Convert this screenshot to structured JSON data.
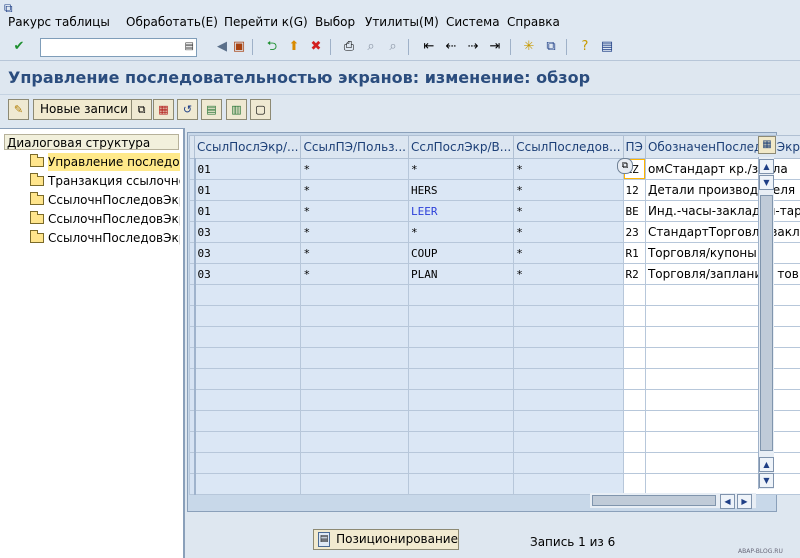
{
  "menubar": {
    "items": [
      "Ракурс таблицы",
      "Обработать(E)",
      "Перейти к(G)",
      "Выбор",
      "Утилиты(M)",
      "Система",
      "Справка"
    ]
  },
  "toolbar": {
    "command_field_value": "",
    "icons": [
      "enter-icon",
      "command-history-icon",
      "back-icon",
      "save-icon",
      "back-green-icon",
      "exit-icon",
      "cancel-icon",
      "print-icon",
      "find-icon",
      "find-next-icon",
      "first-page-icon",
      "previous-page-icon",
      "next-page-icon",
      "last-page-icon",
      "new-session-icon",
      "shortcut-icon",
      "help-icon",
      "layout-menu-icon"
    ]
  },
  "title": {
    "text": "Управление последовательностью экранов: изменение: обзор"
  },
  "app_toolbar": {
    "new_entries_label": "Новые записи",
    "icons": [
      "display-change-icon",
      "copy-icon",
      "delete-icon",
      "undo-icon",
      "select-all-icon",
      "select-block-icon",
      "deselect-all-icon"
    ]
  },
  "tree": {
    "header": "Диалоговая структура",
    "nodes": [
      {
        "label": "Управление последова",
        "selected": true
      },
      {
        "label": "Транзакция ссылочной",
        "selected": false
      },
      {
        "label": "СсылочнПоследовЭкра",
        "selected": false
      },
      {
        "label": "СсылочнПоследовЭкра",
        "selected": false
      },
      {
        "label": "СсылочнПоследовЭкра",
        "selected": false
      }
    ]
  },
  "table": {
    "columns": [
      "СсылПослЭкр/...",
      "СсылПЭ/Польз...",
      "СслПослЭкр/В...",
      "СсылПоследов...",
      "ПЭ",
      "ОбозначенПоследовЭкр"
    ],
    "rows": [
      [
        "01",
        "*",
        "*",
        "*",
        "ZZ",
        "омСтандарт кр./закла"
      ],
      [
        "01",
        "*",
        "HERS",
        "*",
        "12",
        "Детали производителя"
      ],
      [
        "01",
        "*",
        "LEER",
        "*",
        "BE",
        "Инд.-часы-закладки-тара"
      ],
      [
        "03",
        "*",
        "*",
        "*",
        "23",
        "СтандартТорговли закла"
      ],
      [
        "03",
        "*",
        "COUP",
        "*",
        "R1",
        "Торговля/купоны"
      ],
      [
        "03",
        "*",
        "PLAN",
        "*",
        "R2",
        "Торговля/запланир. тов"
      ],
      [
        "",
        "",
        "",
        "",
        "",
        ""
      ],
      [
        "",
        "",
        "",
        "",
        "",
        ""
      ],
      [
        "",
        "",
        "",
        "",
        "",
        ""
      ],
      [
        "",
        "",
        "",
        "",
        "",
        ""
      ],
      [
        "",
        "",
        "",
        "",
        "",
        ""
      ],
      [
        "",
        "",
        "",
        "",
        "",
        ""
      ],
      [
        "",
        "",
        "",
        "",
        "",
        ""
      ],
      [
        "",
        "",
        "",
        "",
        "",
        ""
      ],
      [
        "",
        "",
        "",
        "",
        "",
        ""
      ],
      [
        "",
        "",
        "",
        "",
        "",
        ""
      ]
    ],
    "link_cell": {
      "row": 2,
      "col": 2
    },
    "focused_cell": {
      "row": 0,
      "col": 4
    }
  },
  "footer": {
    "positioning_label": "Позиционирование",
    "entry_counter": "Запись 1 из 6"
  },
  "watermark": "ABAP-BLOG.RU",
  "colors": {
    "background": "#dee7f0",
    "title": "#2b4d7e",
    "selected_node": "#ffe98a",
    "link": "#2c40d9"
  }
}
